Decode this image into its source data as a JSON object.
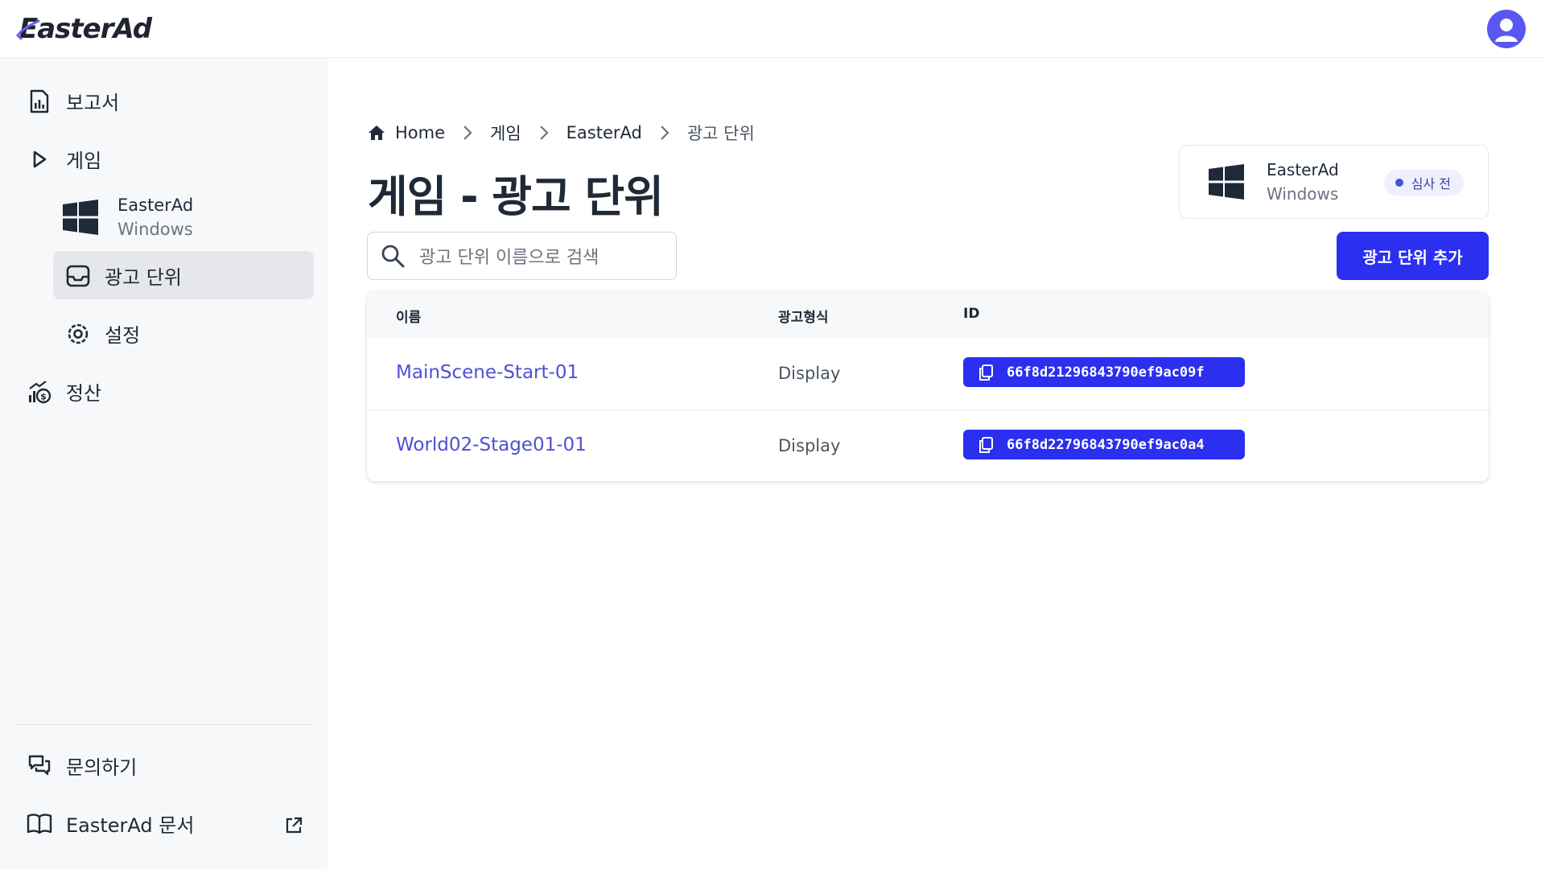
{
  "header": {
    "logo_text": "EasterAd",
    "avatar_icon": "user-circle-icon"
  },
  "sidebar": {
    "items": [
      {
        "label": "보고서",
        "icon": "report-icon"
      },
      {
        "label": "게임",
        "icon": "play-icon"
      },
      {
        "label": "광고 단위",
        "icon": "inbox-icon",
        "active": true
      },
      {
        "label": "설정",
        "icon": "gear-icon"
      },
      {
        "label": "정산",
        "icon": "settlement-icon"
      }
    ],
    "game": {
      "name": "EasterAd",
      "platform": "Windows",
      "icon": "windows-icon"
    },
    "footer": [
      {
        "label": "문의하기",
        "icon": "chat-icon"
      },
      {
        "label": "EasterAd 문서",
        "icon": "book-icon",
        "external_icon": "external-link-icon"
      }
    ]
  },
  "breadcrumb": {
    "home": "Home",
    "items": [
      "게임",
      "EasterAd",
      "광고 단위"
    ]
  },
  "page": {
    "title": "게임 - 광고 단위"
  },
  "app_card": {
    "name": "EasterAd",
    "platform": "Windows",
    "status": "심사 전"
  },
  "search": {
    "placeholder": "광고 단위 이름으로 검색"
  },
  "add_button": {
    "label": "광고 단위 추가"
  },
  "table": {
    "columns": [
      "이름",
      "광고형식",
      "ID"
    ],
    "rows": [
      {
        "name": "MainScene-Start-01",
        "format": "Display",
        "id": "66f8d21296843790ef9ac09f"
      },
      {
        "name": "World02-Stage01-01",
        "format": "Display",
        "id": "66f8d22796843790ef9ac0a4"
      }
    ]
  },
  "colors": {
    "accent": "#2a2ff0",
    "link": "#4f4fd6",
    "sidebar_bg": "#f7f8fa"
  }
}
